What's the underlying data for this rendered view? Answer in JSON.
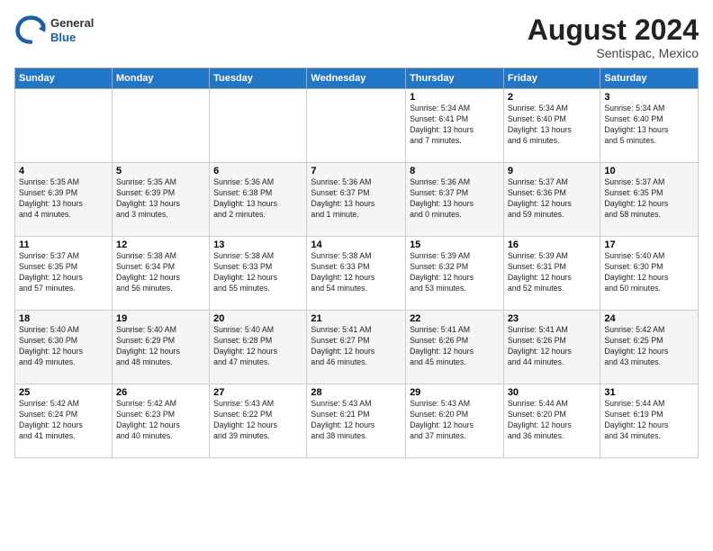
{
  "header": {
    "logo_general": "General",
    "logo_blue": "Blue",
    "month_year": "August 2024",
    "location": "Sentispac, Mexico"
  },
  "columns": [
    "Sunday",
    "Monday",
    "Tuesday",
    "Wednesday",
    "Thursday",
    "Friday",
    "Saturday"
  ],
  "weeks": [
    [
      {
        "day": "",
        "info": ""
      },
      {
        "day": "",
        "info": ""
      },
      {
        "day": "",
        "info": ""
      },
      {
        "day": "",
        "info": ""
      },
      {
        "day": "1",
        "info": "Sunrise: 5:34 AM\nSunset: 6:41 PM\nDaylight: 13 hours\nand 7 minutes."
      },
      {
        "day": "2",
        "info": "Sunrise: 5:34 AM\nSunset: 6:40 PM\nDaylight: 13 hours\nand 6 minutes."
      },
      {
        "day": "3",
        "info": "Sunrise: 5:34 AM\nSunset: 6:40 PM\nDaylight: 13 hours\nand 5 minutes."
      }
    ],
    [
      {
        "day": "4",
        "info": "Sunrise: 5:35 AM\nSunset: 6:39 PM\nDaylight: 13 hours\nand 4 minutes."
      },
      {
        "day": "5",
        "info": "Sunrise: 5:35 AM\nSunset: 6:39 PM\nDaylight: 13 hours\nand 3 minutes."
      },
      {
        "day": "6",
        "info": "Sunrise: 5:36 AM\nSunset: 6:38 PM\nDaylight: 13 hours\nand 2 minutes."
      },
      {
        "day": "7",
        "info": "Sunrise: 5:36 AM\nSunset: 6:37 PM\nDaylight: 13 hours\nand 1 minute."
      },
      {
        "day": "8",
        "info": "Sunrise: 5:36 AM\nSunset: 6:37 PM\nDaylight: 13 hours\nand 0 minutes."
      },
      {
        "day": "9",
        "info": "Sunrise: 5:37 AM\nSunset: 6:36 PM\nDaylight: 12 hours\nand 59 minutes."
      },
      {
        "day": "10",
        "info": "Sunrise: 5:37 AM\nSunset: 6:35 PM\nDaylight: 12 hours\nand 58 minutes."
      }
    ],
    [
      {
        "day": "11",
        "info": "Sunrise: 5:37 AM\nSunset: 6:35 PM\nDaylight: 12 hours\nand 57 minutes."
      },
      {
        "day": "12",
        "info": "Sunrise: 5:38 AM\nSunset: 6:34 PM\nDaylight: 12 hours\nand 56 minutes."
      },
      {
        "day": "13",
        "info": "Sunrise: 5:38 AM\nSunset: 6:33 PM\nDaylight: 12 hours\nand 55 minutes."
      },
      {
        "day": "14",
        "info": "Sunrise: 5:38 AM\nSunset: 6:33 PM\nDaylight: 12 hours\nand 54 minutes."
      },
      {
        "day": "15",
        "info": "Sunrise: 5:39 AM\nSunset: 6:32 PM\nDaylight: 12 hours\nand 53 minutes."
      },
      {
        "day": "16",
        "info": "Sunrise: 5:39 AM\nSunset: 6:31 PM\nDaylight: 12 hours\nand 52 minutes."
      },
      {
        "day": "17",
        "info": "Sunrise: 5:40 AM\nSunset: 6:30 PM\nDaylight: 12 hours\nand 50 minutes."
      }
    ],
    [
      {
        "day": "18",
        "info": "Sunrise: 5:40 AM\nSunset: 6:30 PM\nDaylight: 12 hours\nand 49 minutes."
      },
      {
        "day": "19",
        "info": "Sunrise: 5:40 AM\nSunset: 6:29 PM\nDaylight: 12 hours\nand 48 minutes."
      },
      {
        "day": "20",
        "info": "Sunrise: 5:40 AM\nSunset: 6:28 PM\nDaylight: 12 hours\nand 47 minutes."
      },
      {
        "day": "21",
        "info": "Sunrise: 5:41 AM\nSunset: 6:27 PM\nDaylight: 12 hours\nand 46 minutes."
      },
      {
        "day": "22",
        "info": "Sunrise: 5:41 AM\nSunset: 6:26 PM\nDaylight: 12 hours\nand 45 minutes."
      },
      {
        "day": "23",
        "info": "Sunrise: 5:41 AM\nSunset: 6:26 PM\nDaylight: 12 hours\nand 44 minutes."
      },
      {
        "day": "24",
        "info": "Sunrise: 5:42 AM\nSunset: 6:25 PM\nDaylight: 12 hours\nand 43 minutes."
      }
    ],
    [
      {
        "day": "25",
        "info": "Sunrise: 5:42 AM\nSunset: 6:24 PM\nDaylight: 12 hours\nand 41 minutes."
      },
      {
        "day": "26",
        "info": "Sunrise: 5:42 AM\nSunset: 6:23 PM\nDaylight: 12 hours\nand 40 minutes."
      },
      {
        "day": "27",
        "info": "Sunrise: 5:43 AM\nSunset: 6:22 PM\nDaylight: 12 hours\nand 39 minutes."
      },
      {
        "day": "28",
        "info": "Sunrise: 5:43 AM\nSunset: 6:21 PM\nDaylight: 12 hours\nand 38 minutes."
      },
      {
        "day": "29",
        "info": "Sunrise: 5:43 AM\nSunset: 6:20 PM\nDaylight: 12 hours\nand 37 minutes."
      },
      {
        "day": "30",
        "info": "Sunrise: 5:44 AM\nSunset: 6:20 PM\nDaylight: 12 hours\nand 36 minutes."
      },
      {
        "day": "31",
        "info": "Sunrise: 5:44 AM\nSunset: 6:19 PM\nDaylight: 12 hours\nand 34 minutes."
      }
    ]
  ]
}
